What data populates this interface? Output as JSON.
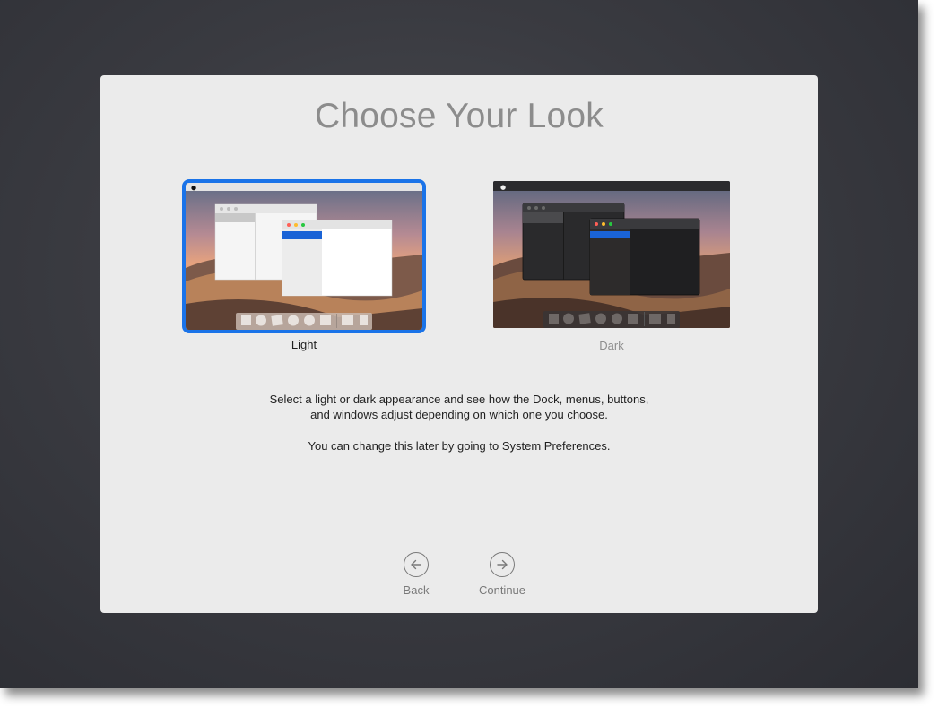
{
  "title": "Choose Your Look",
  "options": [
    {
      "label": "Light",
      "selected": true
    },
    {
      "label": "Dark",
      "selected": false
    }
  ],
  "description": {
    "line1": "Select a light or dark appearance and see how the Dock, menus, buttons,",
    "line2": "and windows adjust depending on which one you choose.",
    "line3": "You can change this later by going to System Preferences."
  },
  "buttons": {
    "back": "Back",
    "continue": "Continue"
  },
  "colors": {
    "selection_border": "#1a73e8",
    "panel_background": "#ebebeb",
    "title_text": "#8c8c8c"
  },
  "icons": {
    "back": "arrow-left-circle-icon",
    "continue": "arrow-right-circle-icon"
  }
}
